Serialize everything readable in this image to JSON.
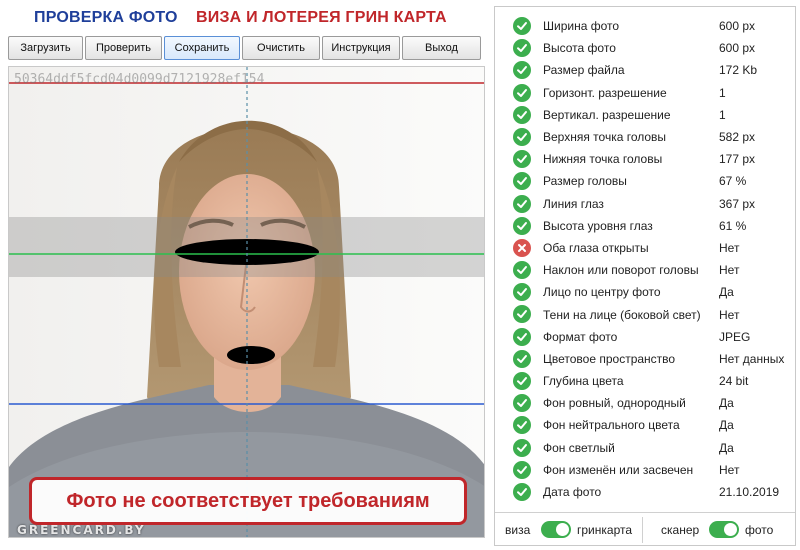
{
  "header": {
    "title_check": "ПРОВЕРКА ФОТО",
    "title_visa": "ВИЗА И ЛОТЕРЕЯ ГРИН КАРТА",
    "title_check_color": "#1f3f9a",
    "title_visa_color": "#c0262a"
  },
  "toolbar": {
    "load": "Загрузить",
    "check": "Проверить",
    "save": "Сохранить",
    "clear": "Очистить",
    "instruction": "Инструкция",
    "exit": "Выход"
  },
  "photo": {
    "hash": "50364ddf5fcd04d0099d7121928ef154",
    "watermark": "GREENCARD.BY",
    "verdict": "Фото не соответствует требованиям"
  },
  "checks": [
    {
      "label": "Ширина фото",
      "value": "600 px",
      "status": "ok"
    },
    {
      "label": "Высота фото",
      "value": "600 px",
      "status": "ok"
    },
    {
      "label": "Размер файла",
      "value": "172 Kb",
      "status": "ok"
    },
    {
      "label": "Горизонт. разрешение",
      "value": "1",
      "status": "ok"
    },
    {
      "label": "Вертикал. разрешение",
      "value": "1",
      "status": "ok"
    },
    {
      "label": "Верхняя точка головы",
      "value": "582 px",
      "status": "ok"
    },
    {
      "label": "Нижняя точка головы",
      "value": "177 px",
      "status": "ok"
    },
    {
      "label": "Размер головы",
      "value": "67 %",
      "status": "ok"
    },
    {
      "label": "Линия глаз",
      "value": "367 px",
      "status": "ok"
    },
    {
      "label": "Высота уровня глаз",
      "value": "61 %",
      "status": "ok"
    },
    {
      "label": "Оба глаза открыты",
      "value": "Нет",
      "status": "fail"
    },
    {
      "label": "Наклон или поворот головы",
      "value": "Нет",
      "status": "ok"
    },
    {
      "label": "Лицо по центру фото",
      "value": "Да",
      "status": "ok"
    },
    {
      "label": "Тени на лице (боковой свет)",
      "value": "Нет",
      "status": "ok"
    },
    {
      "label": "Формат фото",
      "value": "JPEG",
      "status": "ok"
    },
    {
      "label": "Цветовое пространство",
      "value": "Нет данных",
      "status": "ok"
    },
    {
      "label": "Глубина цвета",
      "value": "24 bit",
      "status": "ok"
    },
    {
      "label": "Фон ровный, однородный",
      "value": "Да",
      "status": "ok"
    },
    {
      "label": "Фон нейтрального цвета",
      "value": "Да",
      "status": "ok"
    },
    {
      "label": "Фон светлый",
      "value": "Да",
      "status": "ok"
    },
    {
      "label": "Фон изменён или засвечен",
      "value": "Нет",
      "status": "ok"
    },
    {
      "label": "Дата фото",
      "value": "21.10.2019",
      "status": "ok"
    }
  ],
  "status_colors": {
    "ok": "#3cae4e",
    "fail": "#d9534f"
  },
  "icons": {
    "ok": "check-circle-icon",
    "fail": "x-circle-icon"
  },
  "footer": {
    "visa": "виза",
    "greencard": "гринкарта",
    "scanner": "сканер",
    "photo": "фото",
    "mode_toggle_on": true,
    "source_toggle_on": true
  }
}
